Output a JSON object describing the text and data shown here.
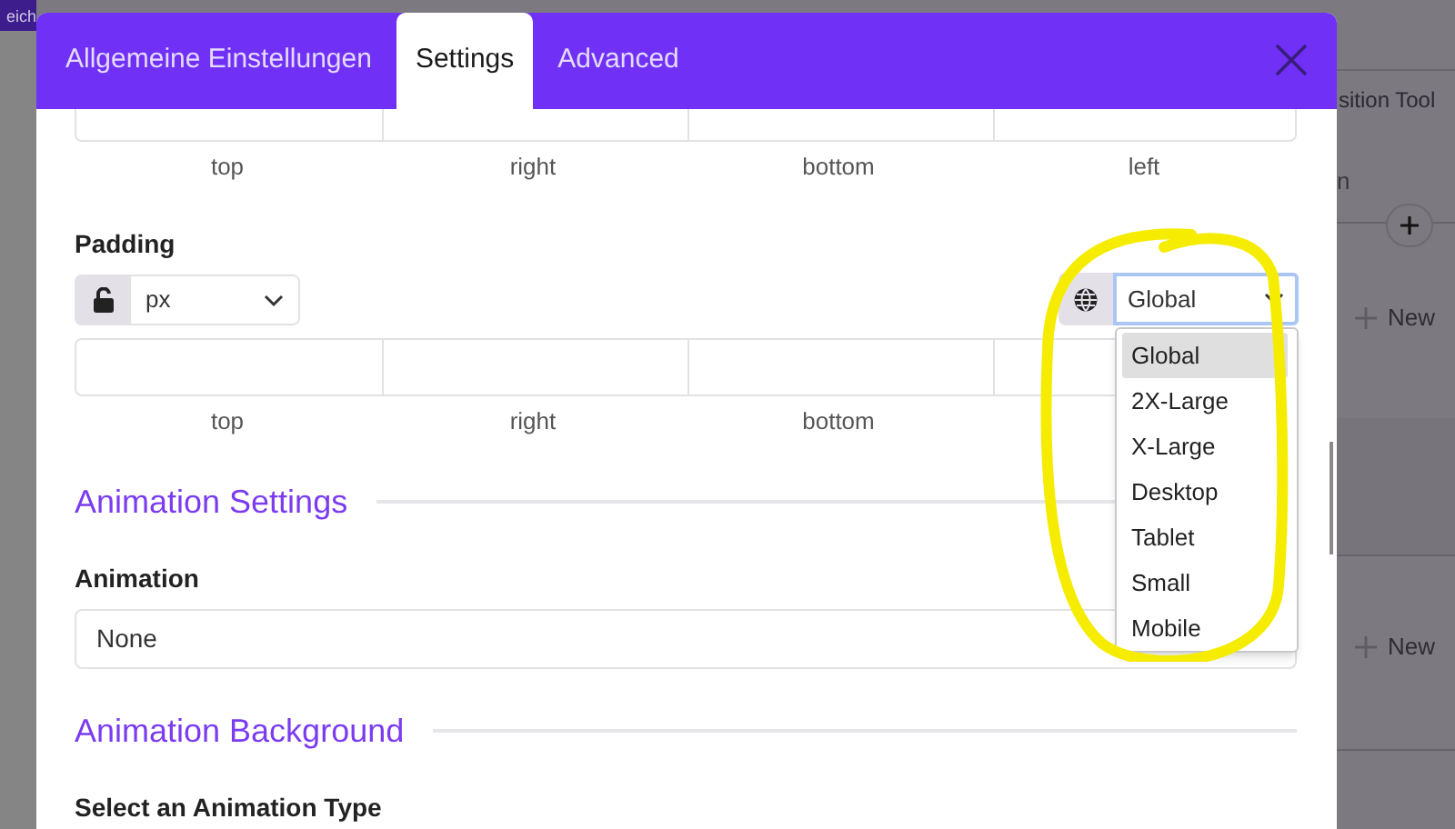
{
  "background": {
    "save_button": "eich",
    "panel_title": "sition Tool",
    "panel_label": "n",
    "new_row_buttons": [
      "New",
      "New"
    ]
  },
  "tabs": [
    {
      "label": "Allgemeine Einstellungen",
      "selected": false
    },
    {
      "label": "Settings",
      "selected": true
    },
    {
      "label": "Advanced",
      "selected": false
    }
  ],
  "margin": {
    "labels": [
      "top",
      "right",
      "bottom",
      "left"
    ]
  },
  "padding": {
    "label": "Padding",
    "locked": false,
    "unit": "px",
    "breakpoint": "Global",
    "breakpoint_open": true,
    "breakpoint_options": [
      {
        "label": "Global",
        "selected": true
      },
      {
        "label": "2X-Large",
        "selected": false
      },
      {
        "label": "X-Large",
        "selected": false
      },
      {
        "label": "Desktop",
        "selected": false
      },
      {
        "label": "Tablet",
        "selected": false
      },
      {
        "label": "Small",
        "selected": false
      },
      {
        "label": "Mobile",
        "selected": false
      }
    ],
    "labels": [
      "top",
      "right",
      "bottom"
    ]
  },
  "animation_settings": {
    "heading": "Animation Settings",
    "label": "Animation",
    "value": "None"
  },
  "animation_background": {
    "heading": "Animation Background",
    "label": "Select an Animation Type"
  }
}
